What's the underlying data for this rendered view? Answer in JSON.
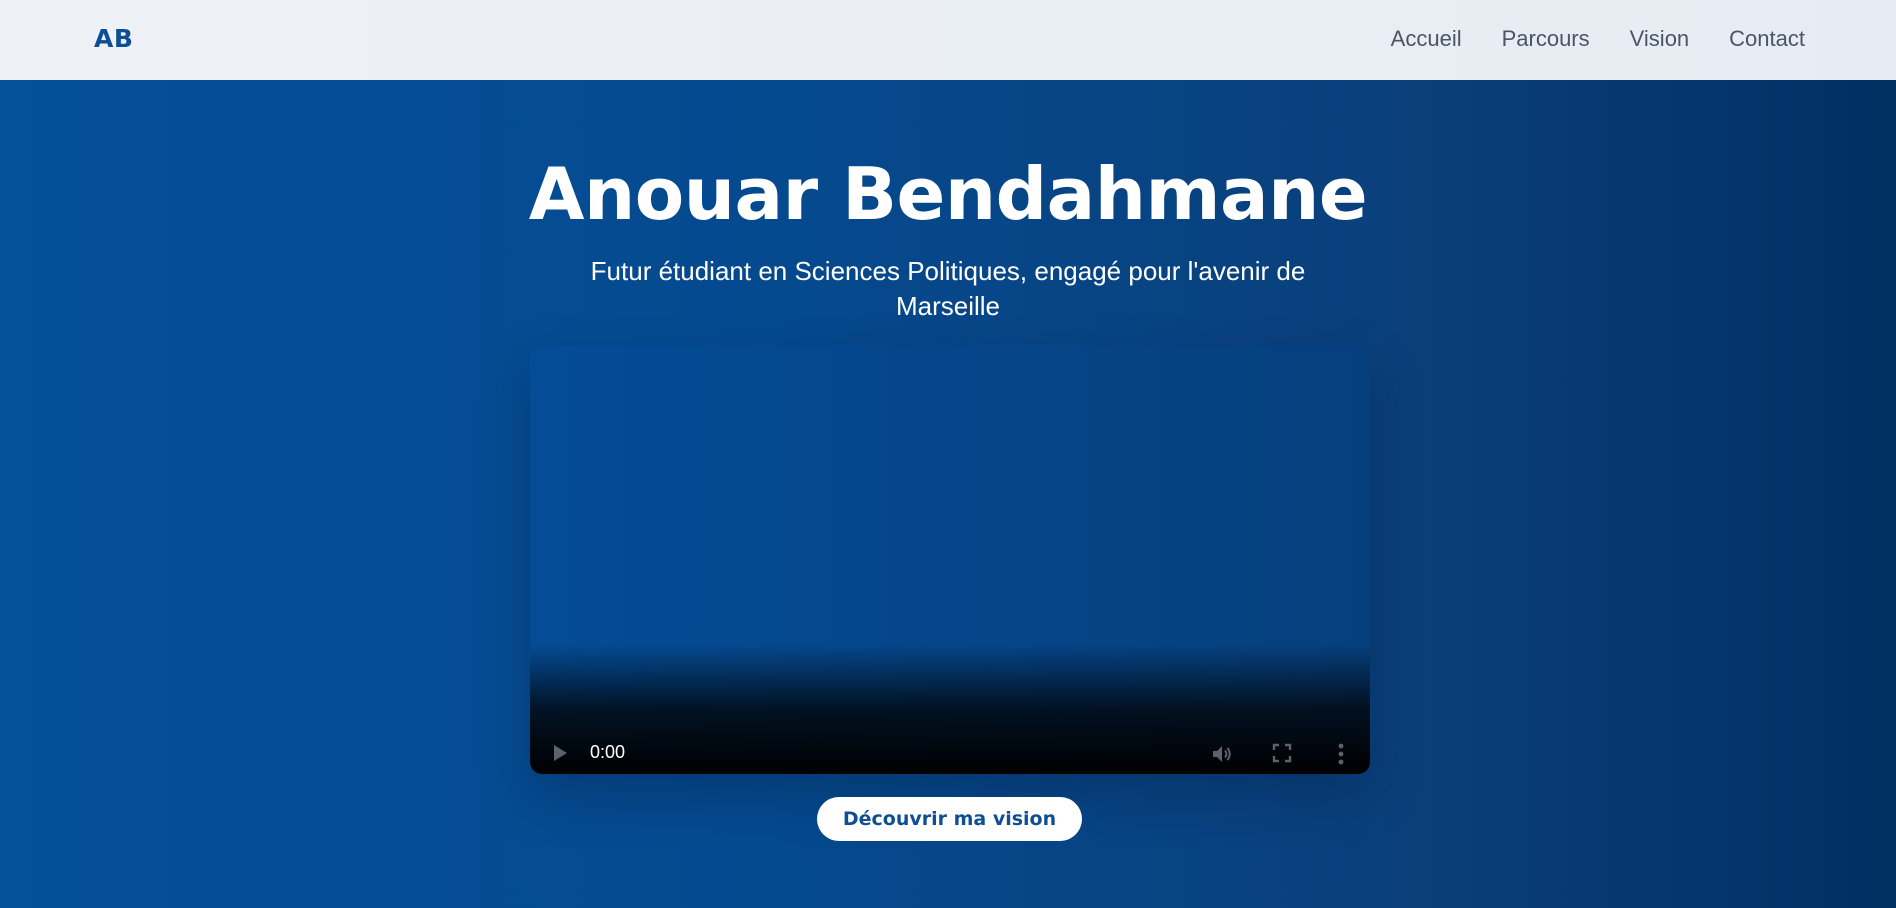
{
  "nav": {
    "logo": "AB",
    "links": [
      "Accueil",
      "Parcours",
      "Vision",
      "Contact"
    ]
  },
  "hero": {
    "title": "Anouar Bendahmane",
    "subtitle": "Futur étudiant en Sciences Politiques, engagé pour l'avenir de Marseille",
    "video": {
      "time": "0:00",
      "progress": 0
    },
    "cta_label": "Découvrir ma vision"
  },
  "colors": {
    "brand": "#0d4f95",
    "hero_bg_start": "#045099",
    "hero_bg_end": "#012f62",
    "nav_bg": "#eef1f6",
    "nav_text": "#4a5565"
  },
  "icons": [
    "play-icon",
    "volume-icon",
    "fullscreen-icon",
    "more-vertical-icon"
  ]
}
